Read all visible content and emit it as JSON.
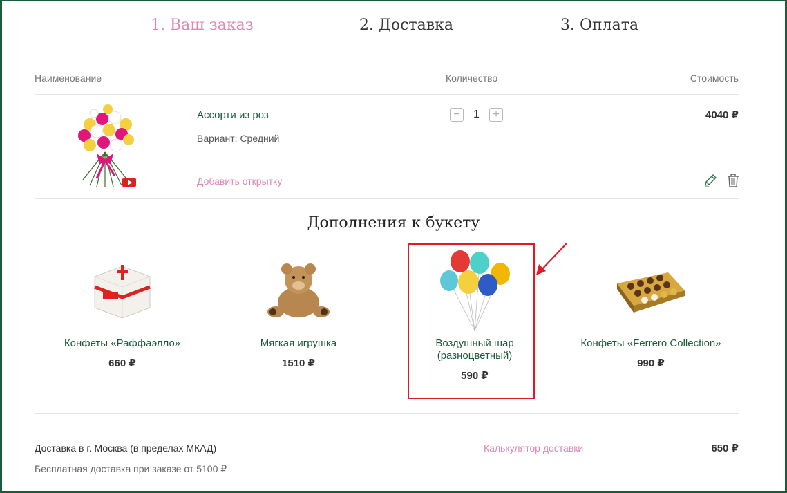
{
  "steps": [
    "1. Ваш заказ",
    "2. Доставка",
    "3. Оплата"
  ],
  "table": {
    "col_name": "Наименование",
    "col_qty": "Количество",
    "col_cost": "Стоимость"
  },
  "product": {
    "name": "Ассорти из роз",
    "variant": "Вариант: Средний",
    "add_card": "Добавить открытку",
    "qty": "1",
    "qty_minus": "−",
    "qty_plus": "+",
    "price": "4040 ₽"
  },
  "addons": {
    "title": "Дополнения к букету",
    "items": [
      {
        "name": "Конфеты «Раффаэлло»",
        "price": "660 ₽"
      },
      {
        "name": "Мягкая игрушка",
        "price": "1510 ₽"
      },
      {
        "name": "Воздушный шар (разноцветный)",
        "price": "590 ₽"
      },
      {
        "name": "Конфеты «Ferrero Collection»",
        "price": "990 ₽"
      }
    ]
  },
  "delivery": {
    "title": "Доставка в г. Москва (в пределах МКАД)",
    "free_note": "Бесплатная доставка при заказе от 5100 ₽",
    "calculator": "Калькулятор доставки",
    "price": "650 ₽"
  },
  "colors": {
    "accent_pink": "#e085b4",
    "brand_green": "#1e5b3a",
    "highlight_red": "#e01b24"
  },
  "icons": [
    "youtube-icon",
    "pencil-icon",
    "trash-icon",
    "minus-icon",
    "plus-icon",
    "arrow-icon"
  ]
}
